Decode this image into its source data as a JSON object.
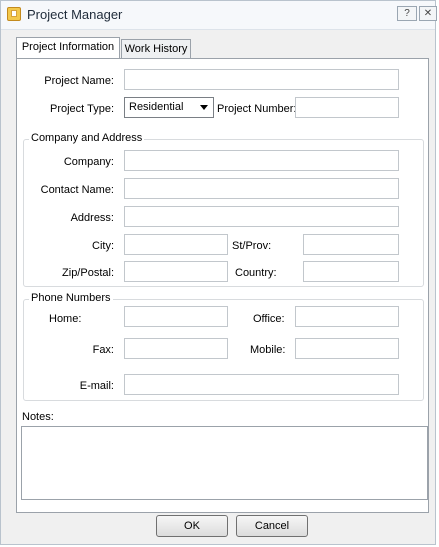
{
  "window": {
    "title": "Project Manager",
    "help_glyph": "?",
    "close_glyph": "✕"
  },
  "tabs": [
    {
      "label": "Project Information",
      "active": true
    },
    {
      "label": "Work History",
      "active": false
    }
  ],
  "project": {
    "name_label": "Project Name:",
    "type_label": "Project Type:",
    "type_value": "Residential",
    "number_label": "Project Number:"
  },
  "company": {
    "legend": "Company and Address",
    "company_label": "Company:",
    "contact_label": "Contact Name:",
    "address_label": "Address:",
    "city_label": "City:",
    "stprov_label": "St/Prov:",
    "zip_label": "Zip/Postal:",
    "country_label": "Country:"
  },
  "phone": {
    "legend": "Phone Numbers",
    "home_label": "Home:",
    "office_label": "Office:",
    "fax_label": "Fax:",
    "mobile_label": "Mobile:",
    "email_label": "E-mail:"
  },
  "notes": {
    "label": "Notes:"
  },
  "buttons": {
    "ok": "OK",
    "cancel": "Cancel"
  },
  "colors": {
    "title_text": "#1f2b3a",
    "panel_border": "#9ba2aa",
    "dialog_bg": "#f0f0f0"
  }
}
